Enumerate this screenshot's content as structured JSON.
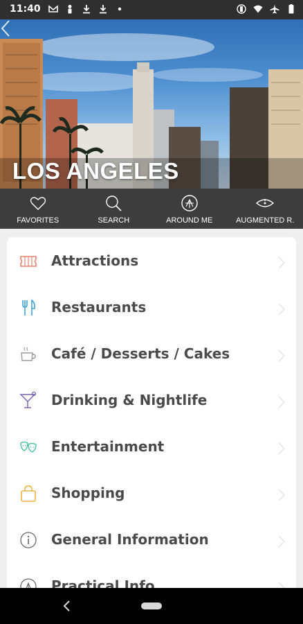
{
  "status_bar": {
    "time": "11:40",
    "left_icons": [
      "gmail-icon",
      "person-icon",
      "download-icon",
      "download-icon",
      "dot-icon"
    ],
    "right_icons": [
      "vibrate-icon",
      "wifi-icon",
      "airplane-icon",
      "battery-icon"
    ]
  },
  "hero": {
    "title": "LOS ANGELES"
  },
  "tabs": [
    {
      "label": "FAVORITES",
      "icon": "heart-icon"
    },
    {
      "label": "SEARCH",
      "icon": "search-icon"
    },
    {
      "label": "AROUND ME",
      "icon": "compass-icon"
    },
    {
      "label": "AUGMENTED R.",
      "icon": "eye-icon"
    }
  ],
  "categories": [
    {
      "label": "Attractions",
      "icon": "ticket-icon",
      "color": "#e8836f"
    },
    {
      "label": "Restaurants",
      "icon": "cutlery-icon",
      "color": "#3fa3d9"
    },
    {
      "label": "Café / Desserts / Cakes",
      "icon": "coffee-icon",
      "color": "#9a9a9a"
    },
    {
      "label": "Drinking & Nightlife",
      "icon": "cocktail-icon",
      "color": "#7b68b0"
    },
    {
      "label": "Entertainment",
      "icon": "masks-icon",
      "color": "#4fc1a6"
    },
    {
      "label": "Shopping",
      "icon": "shopping-bag-icon",
      "color": "#f0b340"
    },
    {
      "label": "General Information",
      "icon": "info-icon",
      "color": "#6a6a6a"
    },
    {
      "label": "Practical Info",
      "icon": "compass-icon",
      "color": "#6a6a6a"
    }
  ]
}
